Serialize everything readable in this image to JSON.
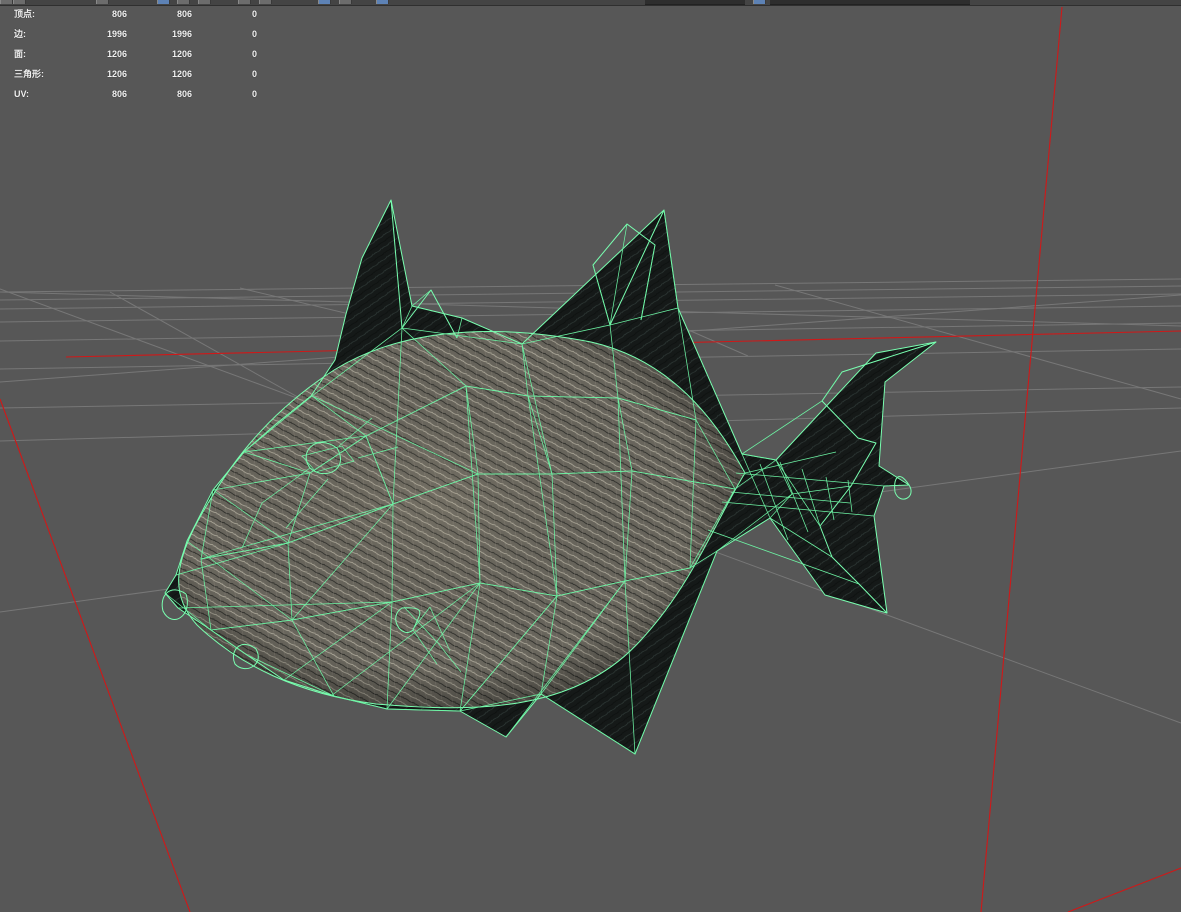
{
  "colors": {
    "viewport_background": "#575757",
    "grid_line": "#777777",
    "axis_line": "#d01818",
    "wireframe": "#79ffb0",
    "dark_fin": "#111514",
    "body_texture": "#6f6a60",
    "active_tool": "#5d82b5"
  },
  "icons": {
    "toolbar": [
      "tool-icon",
      "tool-icon",
      "tool-icon",
      "selection-icon",
      "selection-icon",
      "tool-icon",
      "tool-icon",
      "tool-icon",
      "tool-icon",
      "tool-icon"
    ],
    "viewport": [
      "fish-model-icon"
    ]
  },
  "stats": {
    "rows": [
      {
        "label": "顶点:",
        "values": [
          "806",
          "806",
          "0"
        ]
      },
      {
        "label": "边:",
        "values": [
          "1996",
          "1996",
          "0"
        ]
      },
      {
        "label": "面:",
        "values": [
          "1206",
          "1206",
          "0"
        ]
      },
      {
        "label": "三角形:",
        "values": [
          "1206",
          "1206",
          "0"
        ]
      },
      {
        "label": "UV:",
        "values": [
          "806",
          "806",
          "0"
        ]
      }
    ]
  },
  "viewport": {
    "object": "fish mesh",
    "display_mode": "wireframe on shaded"
  }
}
